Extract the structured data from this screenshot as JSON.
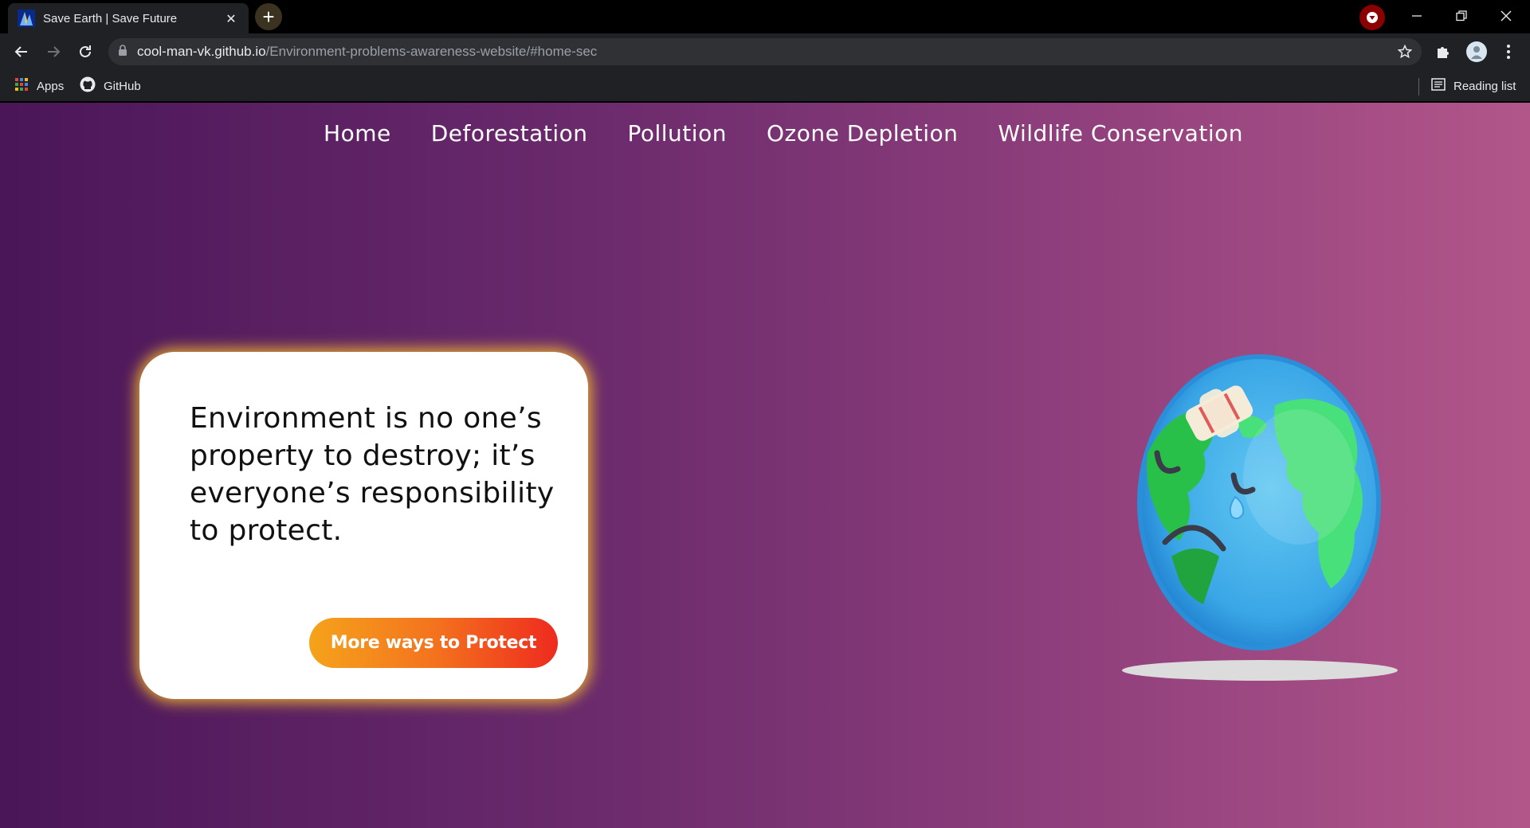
{
  "browser": {
    "tab_title": "Save Earth | Save Future",
    "tab_close": "✕",
    "new_tab": "+",
    "url_domain": "cool-man-vk.github.io",
    "url_path": "/Environment-problems-awareness-website/#home-sec",
    "bookmarks": [
      {
        "label": "Apps",
        "icon": "apps-grid-icon"
      },
      {
        "label": "GitHub",
        "icon": "github-icon"
      }
    ],
    "reading_list": "Reading list"
  },
  "site": {
    "nav": [
      "Home",
      "Deforestation",
      "Pollution",
      "Ozone Depletion",
      "Wildlife Conservation"
    ],
    "quote": "Environment is no one’s property to destroy; it’s everyone’s responsibility to protect.",
    "cta_label": "More ways to Protect"
  },
  "colors": {
    "gradient_start": "#4a1658",
    "gradient_end": "#b2568a",
    "card_glow": "#ffc428",
    "cta_start": "#f5a31b",
    "cta_end": "#ee2a1f"
  }
}
